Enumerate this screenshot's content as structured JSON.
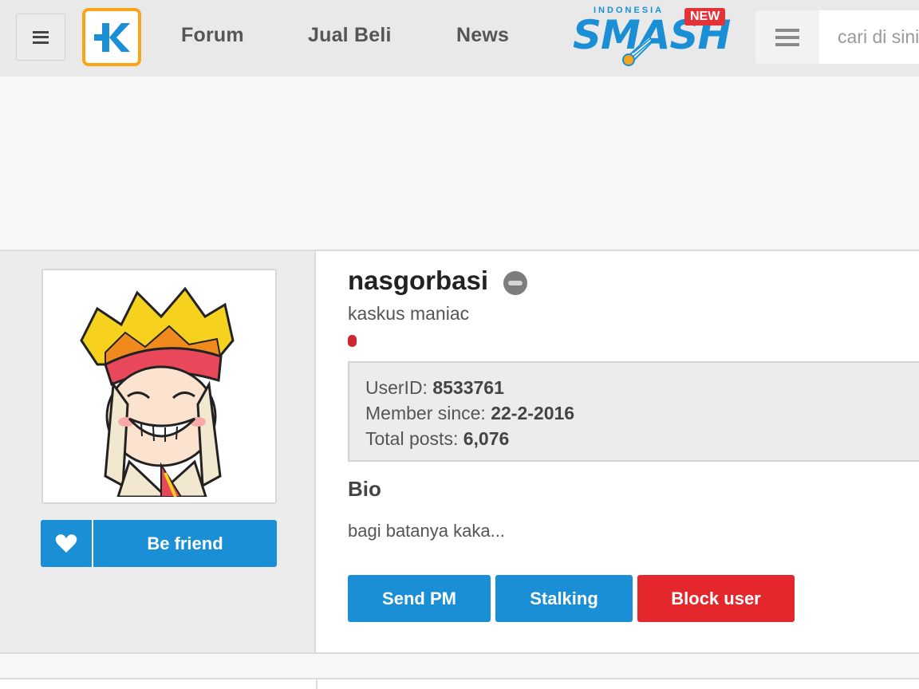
{
  "nav": {
    "menu_icon": "hamburger-icon",
    "logo_icon": "kaskus-logo",
    "brand_color": "#f9a51a",
    "links": [
      {
        "label": "Forum"
      },
      {
        "label": "Jual Beli"
      },
      {
        "label": "News"
      }
    ],
    "smash": {
      "top_text": "INDONESIA",
      "word": "SMASH",
      "badge": "NEW"
    },
    "search": {
      "category_icon": "list-icon",
      "placeholder": "cari di sini"
    }
  },
  "profile": {
    "username": "nasgorbasi",
    "status_icon": "offline-status-icon",
    "rank": "kaskus maniac",
    "rep_color": "#d0262f",
    "info": {
      "userid_label": "UserID: ",
      "userid_value": "8533761",
      "member_label": "Member since: ",
      "member_value": "22-2-2016",
      "posts_label": "Total posts: ",
      "posts_value": "6,076"
    },
    "bio_title": "Bio",
    "bio_text": "bagi batanya kaka...",
    "friend_button": "Be friend",
    "actions": {
      "send_pm": "Send PM",
      "stalking": "Stalking",
      "block": "Block user"
    }
  },
  "colors": {
    "primary": "#1b8fd6",
    "danger": "#e3272d"
  }
}
